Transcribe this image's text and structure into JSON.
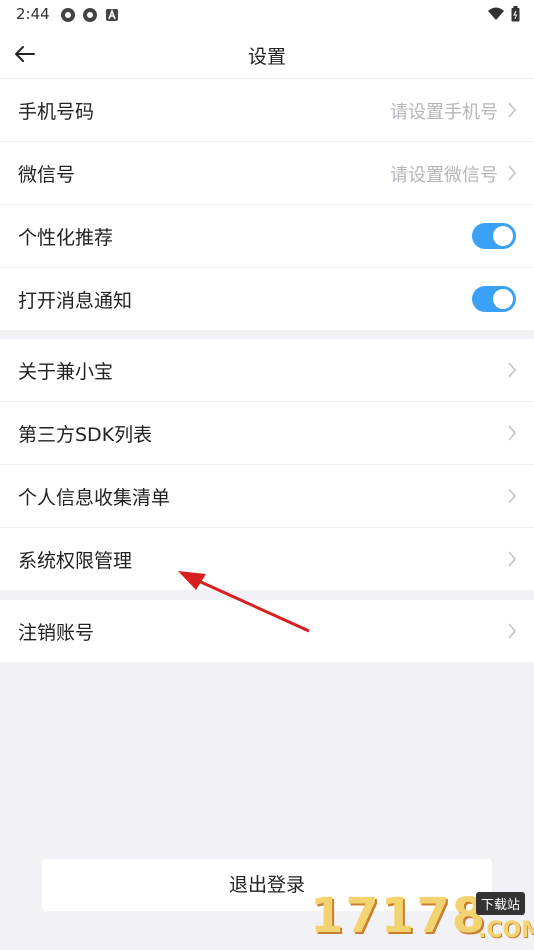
{
  "status": {
    "time": "2:44"
  },
  "header": {
    "title": "设置"
  },
  "group1": {
    "phone_label": "手机号码",
    "phone_hint": "请设置手机号",
    "wechat_label": "微信号",
    "wechat_hint": "请设置微信号",
    "personalized_label": "个性化推荐",
    "personalized_on": true,
    "notify_label": "打开消息通知",
    "notify_on": true
  },
  "group2": {
    "items": [
      {
        "label": "关于兼小宝"
      },
      {
        "label": "第三方SDK列表"
      },
      {
        "label": "个人信息收集清单"
      },
      {
        "label": "系统权限管理"
      }
    ]
  },
  "group3": {
    "cancel_label": "注销账号"
  },
  "logout_label": "退出登录",
  "watermark": {
    "number": "17178",
    "tag": "下载站",
    "domain": ".COM"
  },
  "colors": {
    "toggle": "#3aa1f7",
    "annotation_arrow": "#d61f1f"
  }
}
